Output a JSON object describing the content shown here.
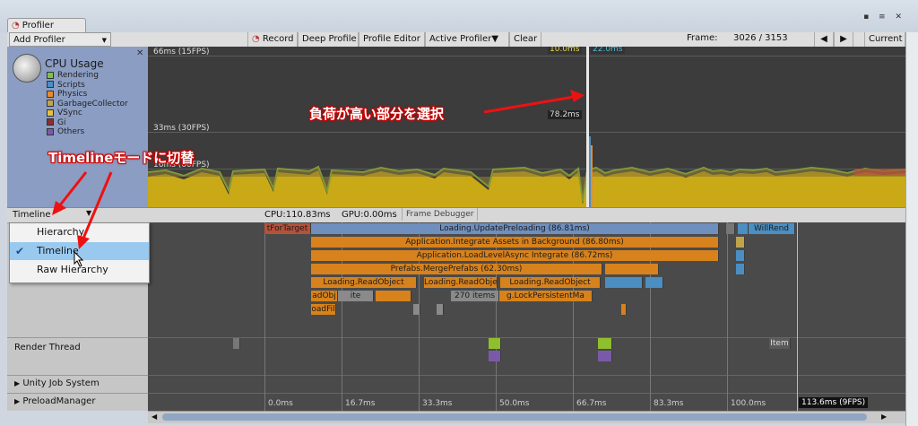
{
  "window": {
    "tab_title": "Profiler",
    "controls": "▪ ≡ ✕"
  },
  "toolbar": {
    "add_profiler": "Add Profiler",
    "record": "Record",
    "deep_profile": "Deep Profile",
    "profile_editor": "Profile Editor",
    "active_profiler": "Active Profiler",
    "clear": "Clear",
    "frame_label": "Frame:",
    "frame_value": "3026 / 3153",
    "current": "Current"
  },
  "cpu": {
    "title": "CPU Usage",
    "legend": [
      {
        "label": "Rendering",
        "color": "#7ec14b"
      },
      {
        "label": "Scripts",
        "color": "#4b8ec1"
      },
      {
        "label": "Physics",
        "color": "#e88a2e"
      },
      {
        "label": "GarbageCollector",
        "color": "#c1a34b"
      },
      {
        "label": "VSync",
        "color": "#e6c040"
      },
      {
        "label": "Gi",
        "color": "#8b2e2e"
      },
      {
        "label": "Others",
        "color": "#7a5aa8"
      }
    ],
    "grid": {
      "top": "66ms (15FPS)",
      "mid": "33ms (30FPS)",
      "low": "16ms (60FPS)"
    },
    "markers": {
      "a": "10.0ms",
      "b": "22.0ms",
      "c": "78.2ms"
    }
  },
  "detail": {
    "mode": "Timeline",
    "cpu": "CPU:110.83ms",
    "gpu": "GPU:0.00ms",
    "frame_debugger": "Frame Debugger"
  },
  "menu": {
    "items": [
      "Hierarchy",
      "Timeline",
      "Raw Hierarchy"
    ],
    "selected": "Timeline"
  },
  "threads": {
    "render": "Render Thread",
    "job": "Unity Job System",
    "preload": "PreloadManager"
  },
  "timeline": {
    "blocks": [
      "tForTarget",
      "Loading.UpdatePreloading (86.81ms)",
      "WillRend",
      "Application.Integrate Assets in Background (86.80ms)",
      "Application.LoadLevelAsync Integrate (86.72ms)",
      "Prefabs.MergePrefabs (62.30ms)",
      "Loading.ReadObject",
      "Loading.ReadObject",
      "Loading.ReadObject",
      "adObj",
      "ite",
      "270 items",
      "g.LockPersistentMa",
      "oadFil",
      "Item"
    ],
    "ticks": [
      "0.0ms",
      "16.7ms",
      "33.3ms",
      "50.0ms",
      "66.7ms",
      "83.3ms",
      "100.0ms",
      "113.6ms (9FPS)"
    ]
  },
  "annotations": {
    "select": "負荷が高い部分を選択",
    "switch": "Timelineモードに切替"
  }
}
